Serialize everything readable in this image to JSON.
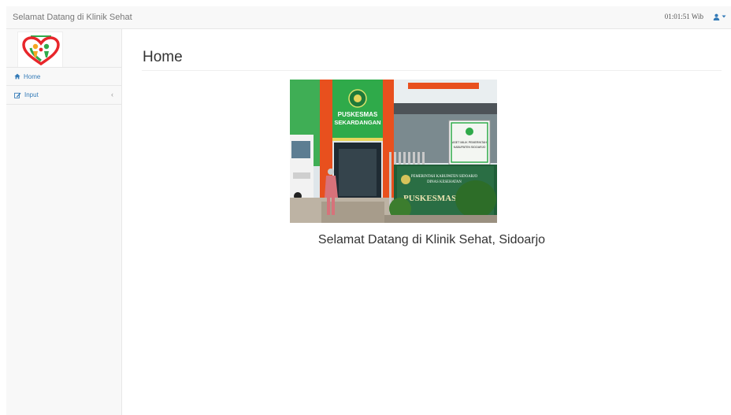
{
  "navbar": {
    "brand": "Selamat Datang di Klinik Sehat",
    "clock": "01:01:51 Wib"
  },
  "sidebar": {
    "items": [
      {
        "label": "Home",
        "icon": "home-icon"
      },
      {
        "label": "Input",
        "icon": "edit-icon"
      }
    ]
  },
  "main": {
    "title": "Home",
    "photo_sign_top": "PUSKESMAS",
    "photo_sign_bottom": "SEKARDANGAN",
    "photo_board_line1": "PEMERINTAH KABUPATEN SIDOARJO",
    "photo_board_line2": "DINAS KESEHATAN",
    "photo_board_name": "PUSKESMAS SEK",
    "photo_small_sign1": "ASET MILIK PEMERINTAH",
    "photo_small_sign2": "KABUPATEN SIDOARJO",
    "welcome": "Selamat Datang di Klinik Sehat, Sidoarjo"
  },
  "colors": {
    "accent": "#337ab7",
    "navbar_bg": "#f8f8f8",
    "building_green": "#2faa4a",
    "building_orange": "#e8501e"
  }
}
